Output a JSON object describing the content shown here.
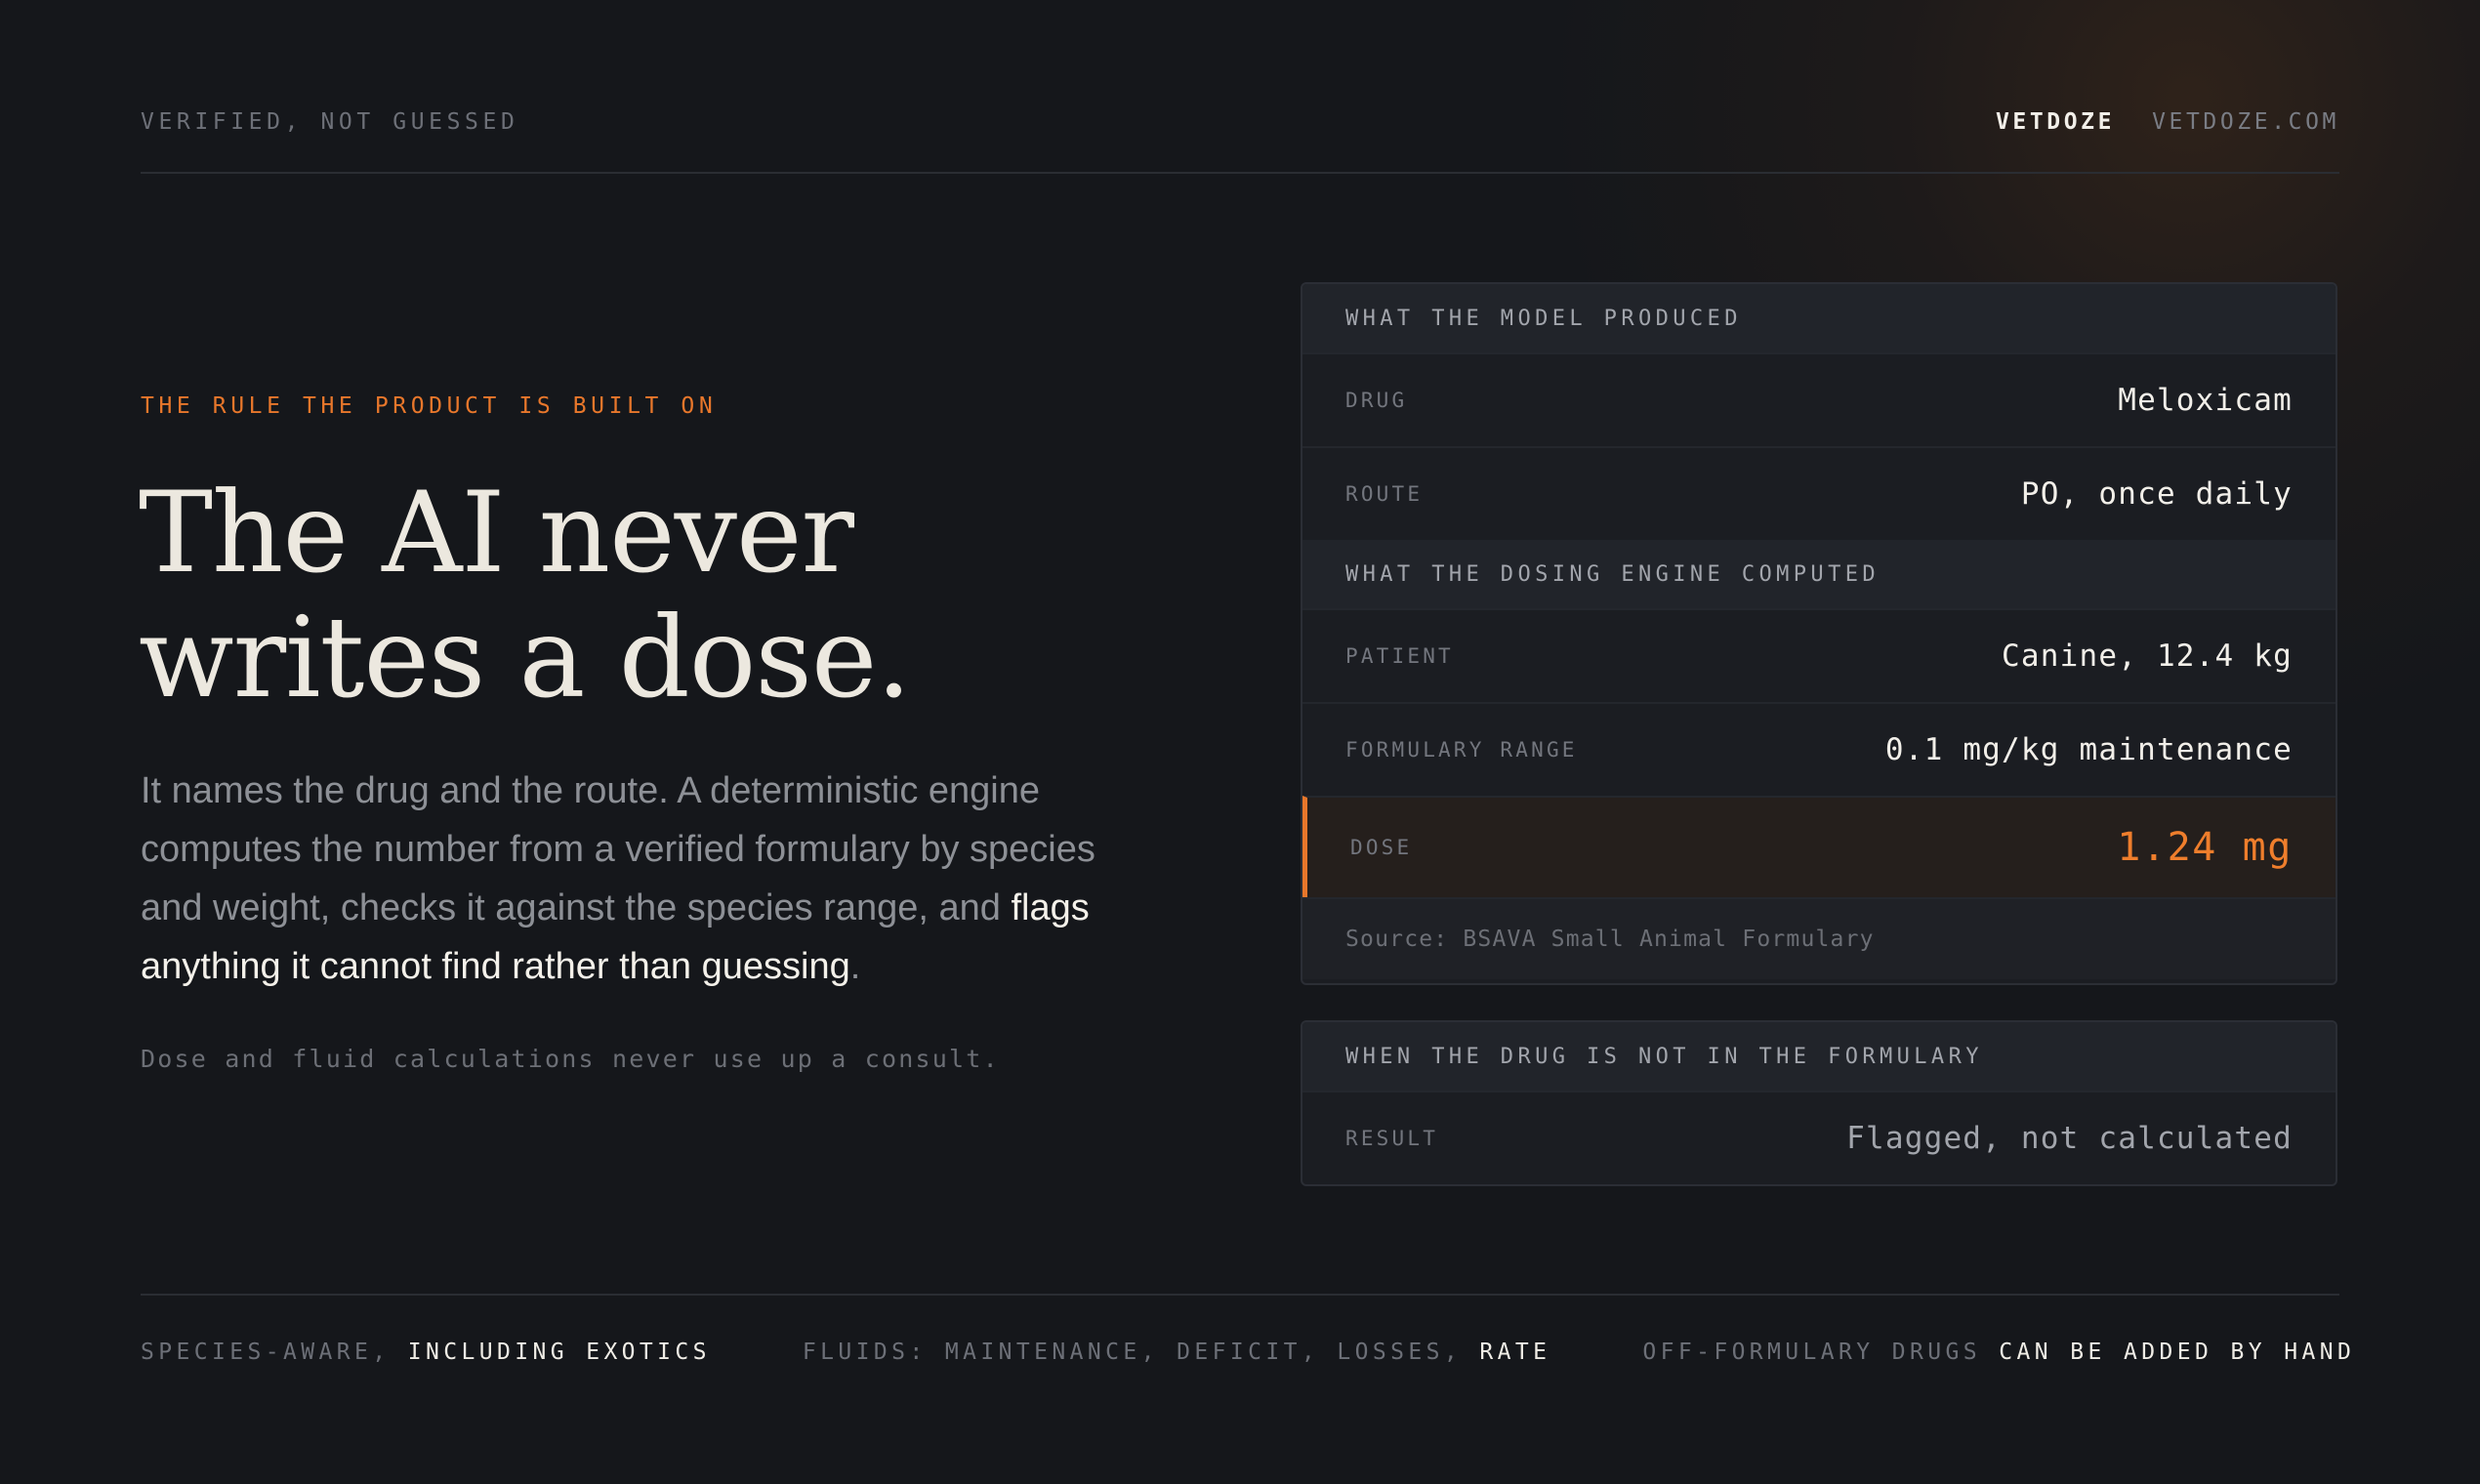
{
  "header": {
    "tagline": "VERIFIED, NOT GUESSED",
    "brand_name": "VETDOZE",
    "brand_url": "VETDOZE.COM"
  },
  "hero": {
    "eyebrow": "THE RULE THE PRODUCT IS BUILT ON",
    "headline_line1": "The AI never",
    "headline_line2": "writes a dose.",
    "body_plain": "It names the drug and the route. A deterministic engine computes the number from a verified formulary by species and weight, checks it against the species range, and ",
    "body_emphasis": "flags anything it cannot find rather than guessing",
    "body_end": ".",
    "footnote": "Dose and fluid calculations never use up a consult."
  },
  "card_main": {
    "section_model": "WHAT THE MODEL PRODUCED",
    "drug_label": "DRUG",
    "drug_value": "Meloxicam",
    "route_label": "ROUTE",
    "route_value": "PO, once daily",
    "section_engine": "WHAT THE DOSING ENGINE COMPUTED",
    "patient_label": "PATIENT",
    "patient_value": "Canine, 12.4 kg",
    "range_label": "FORMULARY RANGE",
    "range_value": "0.1 mg/kg maintenance",
    "dose_label": "DOSE",
    "dose_value": "1.24 mg",
    "source": "Source: BSAVA Small Animal Formulary"
  },
  "card_missing": {
    "section": "WHEN THE DRUG IS NOT IN THE FORMULARY",
    "result_label": "RESULT",
    "result_value": "Flagged, not calculated"
  },
  "features": [
    {
      "dim": "SPECIES-AWARE, ",
      "lit": "INCLUDING EXOTICS"
    },
    {
      "dim": "FLUIDS: MAINTENANCE, DEFICIT, LOSSES, ",
      "lit": "RATE"
    },
    {
      "dim": "OFF-FORMULARY DRUGS ",
      "lit": "CAN BE ADDED BY HAND"
    }
  ],
  "colors": {
    "background": "#15171b",
    "accent": "#e8772b",
    "card": "#1b1d22",
    "section": "#21242a",
    "text": "#ece8df",
    "muted": "#6d7078"
  }
}
